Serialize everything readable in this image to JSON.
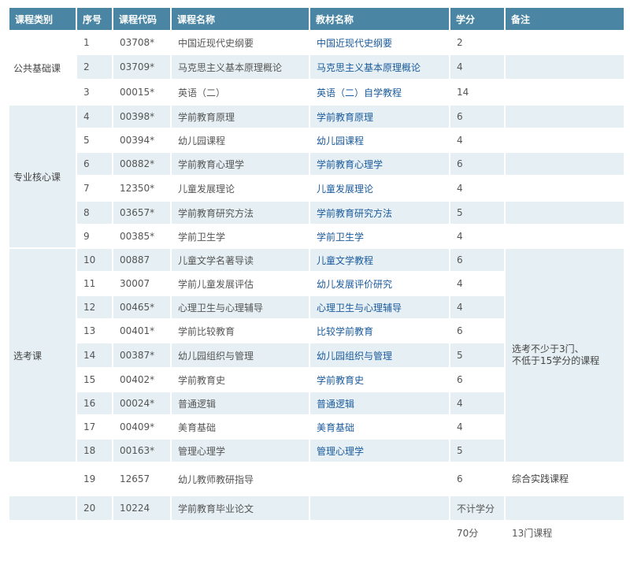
{
  "headers": [
    "课程类别",
    "序号",
    "课程代码",
    "课程名称",
    "教材名称",
    "学分",
    "备注"
  ],
  "categories": {
    "public": "公共基础课",
    "core": "专业核心课",
    "elective": "选考课"
  },
  "elective_note": "选考不少于3门、\n不低于15学分的课程",
  "rows": [
    {
      "no": "1",
      "code": "03708*",
      "name": "中国近现代史纲要",
      "book": "中国近现代史纲要",
      "credit": "2",
      "note": ""
    },
    {
      "no": "2",
      "code": "03709*",
      "name": "马克思主义基本原理概论",
      "book": "马克思主义基本原理概论",
      "credit": "4",
      "note": ""
    },
    {
      "no": "3",
      "code": "00015*",
      "name": "英语（二）",
      "book": "英语（二）自学教程",
      "credit": "14",
      "note": ""
    },
    {
      "no": "4",
      "code": "00398*",
      "name": "学前教育原理",
      "book": "学前教育原理",
      "credit": "6",
      "note": ""
    },
    {
      "no": "5",
      "code": "00394*",
      "name": "幼儿园课程",
      "book": "幼儿园课程",
      "credit": "4",
      "note": ""
    },
    {
      "no": "6",
      "code": "00882*",
      "name": "学前教育心理学",
      "book": "学前教育心理学",
      "credit": "6",
      "note": ""
    },
    {
      "no": "7",
      "code": "12350*",
      "name": "儿童发展理论",
      "book": "儿童发展理论",
      "credit": "4",
      "note": ""
    },
    {
      "no": "8",
      "code": "03657*",
      "name": "学前教育研究方法",
      "book": "学前教育研究方法",
      "credit": "5",
      "note": ""
    },
    {
      "no": "9",
      "code": "00385*",
      "name": "学前卫生学",
      "book": "学前卫生学",
      "credit": "4",
      "note": ""
    },
    {
      "no": "10",
      "code": "00887",
      "name": "儿童文学名著导读",
      "book": "儿童文学教程",
      "credit": "6",
      "note": ""
    },
    {
      "no": "11",
      "code": "30007",
      "name": "学前儿童发展评估",
      "book": "幼儿发展评价研究",
      "credit": "4",
      "note": ""
    },
    {
      "no": "12",
      "code": "00465*",
      "name": "心理卫生与心理辅导",
      "book": "心理卫生与心理辅导",
      "credit": "4",
      "note": ""
    },
    {
      "no": "13",
      "code": "00401*",
      "name": "学前比较教育",
      "book": "比较学前教育",
      "credit": "6",
      "note": ""
    },
    {
      "no": "14",
      "code": "00387*",
      "name": "幼儿园组织与管理",
      "book": "幼儿园组织与管理",
      "credit": "5",
      "note": ""
    },
    {
      "no": "15",
      "code": "00402*",
      "name": "学前教育史",
      "book": "学前教育史",
      "credit": "6",
      "note": ""
    },
    {
      "no": "16",
      "code": "00024*",
      "name": "普通逻辑",
      "book": "普通逻辑",
      "credit": "4",
      "note": ""
    },
    {
      "no": "17",
      "code": "00409*",
      "name": "美育基础",
      "book": "美育基础",
      "credit": "4",
      "note": ""
    },
    {
      "no": "18",
      "code": "00163*",
      "name": "管理心理学",
      "book": "管理心理学",
      "credit": "5",
      "note": ""
    },
    {
      "no": "19",
      "code": "12657",
      "name": "幼儿教师教研指导",
      "book": "",
      "credit": "6",
      "note": "综合实践课程"
    },
    {
      "no": "20",
      "code": "10224",
      "name": "学前教育毕业论文",
      "book": "",
      "credit": "不计学分",
      "note": ""
    }
  ],
  "total": {
    "credit": "70分",
    "note": "13门课程"
  }
}
